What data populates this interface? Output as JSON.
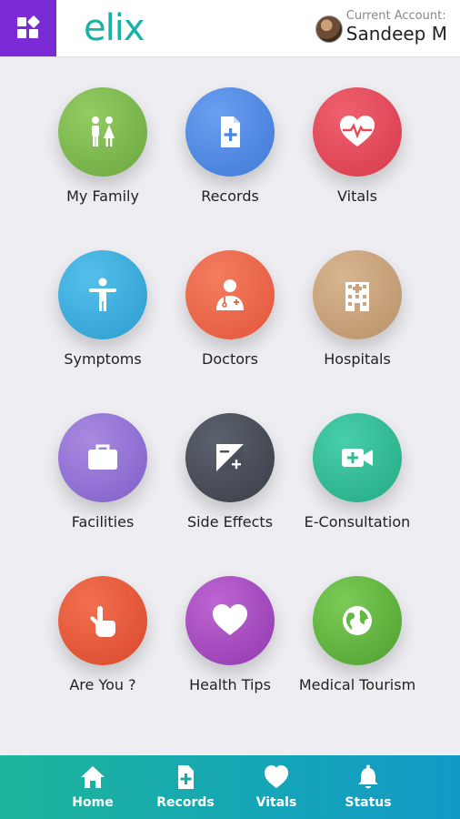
{
  "header": {
    "logo": "elix",
    "account_label": "Current Account:",
    "account_name": "Sandeep M",
    "menu_color": "#7b2bd6",
    "logo_color": "#17b3a8"
  },
  "tiles": [
    {
      "label": "My Family",
      "icon": "family-icon",
      "color": "#7dba4f"
    },
    {
      "label": "Records",
      "icon": "document-plus-icon",
      "color": "#4a86e0"
    },
    {
      "label": "Vitals",
      "icon": "heartbeat-icon",
      "color": "#e34a5a"
    },
    {
      "label": "Symptoms",
      "icon": "person-icon",
      "color": "#37aee0"
    },
    {
      "label": "Doctors",
      "icon": "doctor-icon",
      "color": "#ee6548"
    },
    {
      "label": "Hospitals",
      "icon": "hospital-icon",
      "color": "#c9a47f"
    },
    {
      "label": "Facilities",
      "icon": "briefcase-icon",
      "color": "#9473d4"
    },
    {
      "label": "Side Effects",
      "icon": "side-effects-icon",
      "color": "#4a4f5a"
    },
    {
      "label": "E-Consultation",
      "icon": "video-plus-icon",
      "color": "#2dbd97"
    },
    {
      "label": "Are You ?",
      "icon": "hand-pointer-icon",
      "color": "#ea5738"
    },
    {
      "label": "Health Tips",
      "icon": "heart-icon",
      "color": "#a94bbf"
    },
    {
      "label": "Medical Tourism",
      "icon": "globe-icon",
      "color": "#61b93e"
    }
  ],
  "bottom_nav": [
    {
      "label": "Home",
      "icon": "home-icon"
    },
    {
      "label": "Records",
      "icon": "document-plus-icon"
    },
    {
      "label": "Vitals",
      "icon": "heart-icon"
    },
    {
      "label": "Status",
      "icon": "bell-icon"
    }
  ]
}
